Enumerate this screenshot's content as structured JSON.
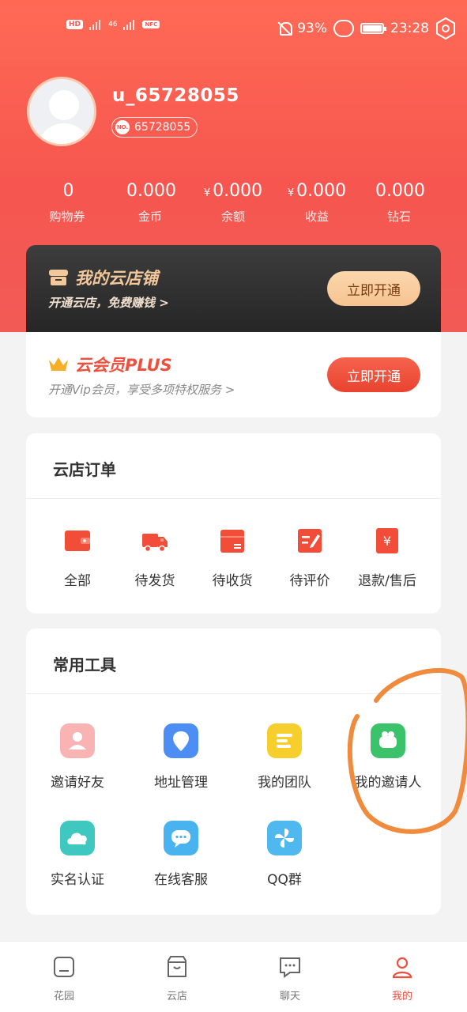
{
  "status_bar": {
    "left_chips": [
      "HD",
      "46"
    ],
    "battery": "93%",
    "time": "23:28"
  },
  "profile": {
    "username": "u_65728055",
    "id_badge": "NO.",
    "id": "65728055"
  },
  "stats": [
    {
      "value": "0",
      "currency": "",
      "label": "购物券"
    },
    {
      "value": "0.000",
      "currency": "",
      "label": "金币"
    },
    {
      "value": "0.000",
      "currency": "¥",
      "label": "余额"
    },
    {
      "value": "0.000",
      "currency": "¥",
      "label": "收益"
    },
    {
      "value": "0.000",
      "currency": "",
      "label": "钻石"
    }
  ],
  "store_card": {
    "title": "我的云店铺",
    "subtitle": "开通云店，免费赚钱 >",
    "button": "立即开通"
  },
  "vip_card": {
    "title": "云会员PLUS",
    "subtitle": "开通Vip会员，享受多项特权服务 >",
    "button": "立即开通"
  },
  "orders": {
    "title": "云店订单",
    "items": [
      {
        "label": "全部",
        "icon": "wallet-icon"
      },
      {
        "label": "待发货",
        "icon": "truck-icon"
      },
      {
        "label": "待收货",
        "icon": "package-icon"
      },
      {
        "label": "待评价",
        "icon": "edit-icon"
      },
      {
        "label": "退款/售后",
        "icon": "refund-icon"
      }
    ]
  },
  "tools": {
    "title": "常用工具",
    "items": [
      {
        "label": "邀请好友",
        "icon": "invite-friend-icon",
        "color": "#f9b3b3"
      },
      {
        "label": "地址管理",
        "icon": "location-icon",
        "color": "#4d8ef5"
      },
      {
        "label": "我的团队",
        "icon": "team-icon",
        "color": "#f7cf2c"
      },
      {
        "label": "我的邀请人",
        "icon": "inviter-icon",
        "color": "#3dc26c"
      },
      {
        "label": "实名认证",
        "icon": "cloud-icon",
        "color": "#3fc8c0"
      },
      {
        "label": "在线客服",
        "icon": "chat-icon",
        "color": "#49b3f0"
      },
      {
        "label": "QQ群",
        "icon": "pinwheel-icon",
        "color": "#4fb9ef"
      }
    ]
  },
  "tabbar": [
    {
      "label": "花园",
      "icon": "garden-icon",
      "active": false
    },
    {
      "label": "云店",
      "icon": "store-icon",
      "active": false
    },
    {
      "label": "聊天",
      "icon": "chat-tab-icon",
      "active": false
    },
    {
      "label": "我的",
      "icon": "profile-icon",
      "active": true
    }
  ],
  "colors": {
    "brand": "#f25a57",
    "accent_red": "#ef4f3d",
    "gold": "#f6c391",
    "annotation": "#f08a3c"
  }
}
